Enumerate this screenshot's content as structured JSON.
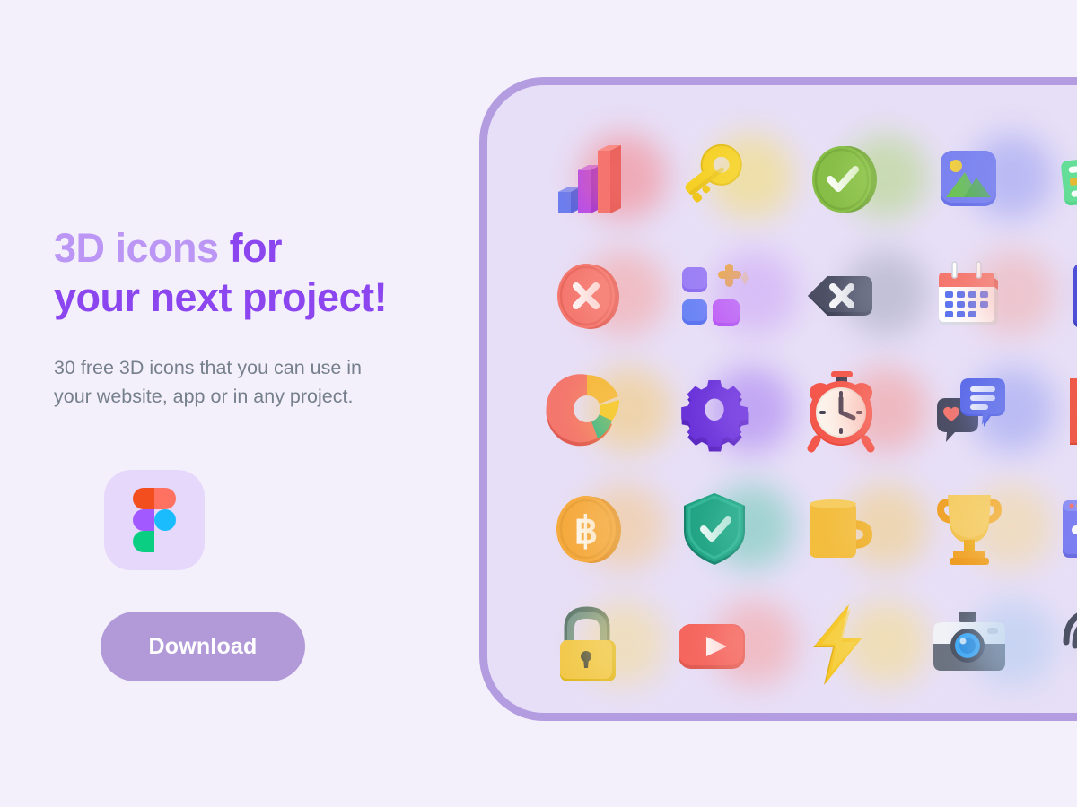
{
  "theme": {
    "page_bg": "#f4f0fb",
    "card_bg": "#e7dff7",
    "card_border": "#b39ce0",
    "headline_light": "#bb96f5",
    "headline_strong": "#8b46f0",
    "subcopy": "#76808d",
    "button_bg": "#b29ad9",
    "button_text": "#ffffff",
    "figma_tile_bg": "#e5d8fb"
  },
  "hero": {
    "headline_part_light": "3D icons",
    "headline_part_strong_1": "for",
    "headline_part_strong_2": "your next project!",
    "subcopy_line_1": "30 free 3D icons that you can use in",
    "subcopy_line_2": "your website, app or in any project.",
    "logo_name": "figma-logo",
    "download_label": "Download"
  },
  "icon_card": {
    "columns": 5,
    "rows": 5,
    "total_icons": 30,
    "icons": [
      {
        "name": "bar-chart-icon",
        "label": "Bar chart",
        "color": "#f87171",
        "glow": "#f87171"
      },
      {
        "name": "key-icon",
        "label": "Key",
        "color": "#f5cf23",
        "glow": "#f7df55"
      },
      {
        "name": "check-circle-icon",
        "label": "Check circle",
        "color": "#7cb342",
        "glow": "#a8d66a"
      },
      {
        "name": "image-icon",
        "label": "Image",
        "color": "#6b72e8",
        "glow": "#8b93f0"
      },
      {
        "name": "credit-card-icon",
        "label": "Credit card",
        "color": "#58d68d",
        "glow": "#7ee0a5"
      },
      {
        "name": "close-circle-icon",
        "label": "Close circle",
        "color": "#f4776e",
        "glow": "#f9998f"
      },
      {
        "name": "add-widget-icon",
        "label": "Add widget",
        "color": "#8b6ef0",
        "glow": "#c79af5"
      },
      {
        "name": "backspace-icon",
        "label": "Backspace",
        "color": "#4b4e63",
        "glow": "#9ba0b5"
      },
      {
        "name": "calendar-icon",
        "label": "Calendar",
        "color": "#f4776e",
        "glow": "#f3a9a2"
      },
      {
        "name": "calculator-icon",
        "label": "Calculator",
        "color": "#4c4ed6",
        "glow": "#7d7ee8"
      },
      {
        "name": "donut-chart-icon",
        "label": "Donut chart",
        "color": "#f4776e",
        "glow": "#f7c85a"
      },
      {
        "name": "settings-gear-icon",
        "label": "Settings gear",
        "color": "#6a33d8",
        "glow": "#9a6af0"
      },
      {
        "name": "alarm-clock-icon",
        "label": "Alarm clock",
        "color": "#f4574b",
        "glow": "#f79187"
      },
      {
        "name": "chat-bubbles-icon",
        "label": "Chat bubbles",
        "color": "#5b6ae8",
        "glow": "#8b96f0"
      },
      {
        "name": "pdf-file-icon",
        "label": "PDF file",
        "color": "#ee5a48",
        "glow": "#f28a7a"
      },
      {
        "name": "bitcoin-coin-icon",
        "label": "Bitcoin coin",
        "color": "#f5a93c",
        "glow": "#f7c476"
      },
      {
        "name": "shield-check-icon",
        "label": "Shield check",
        "color": "#1fa383",
        "glow": "#56c6aa"
      },
      {
        "name": "coffee-mug-icon",
        "label": "Coffee mug",
        "color": "#f0b429",
        "glow": "#f5cd6a"
      },
      {
        "name": "trophy-icon",
        "label": "Trophy",
        "color": "#f2c14e",
        "glow": "#f7d98a"
      },
      {
        "name": "browser-window-icon",
        "label": "Browser window",
        "color": "#7b7ef0",
        "glow": "#a0a3f5"
      },
      {
        "name": "padlock-icon",
        "label": "Padlock",
        "color": "#f2c94c",
        "glow": "#f7dd85"
      },
      {
        "name": "video-play-icon",
        "label": "Video play",
        "color": "#f4665e",
        "glow": "#f99891"
      },
      {
        "name": "lightning-bolt-icon",
        "label": "Lightning bolt",
        "color": "#f5c629",
        "glow": "#f9dd75"
      },
      {
        "name": "camera-icon",
        "label": "Camera",
        "color": "#6b7280",
        "glow": "#a6c8ee"
      },
      {
        "name": "fingerprint-icon",
        "label": "Fingerprint",
        "color": "#4b5163",
        "glow": "#9aa0b2"
      }
    ]
  }
}
